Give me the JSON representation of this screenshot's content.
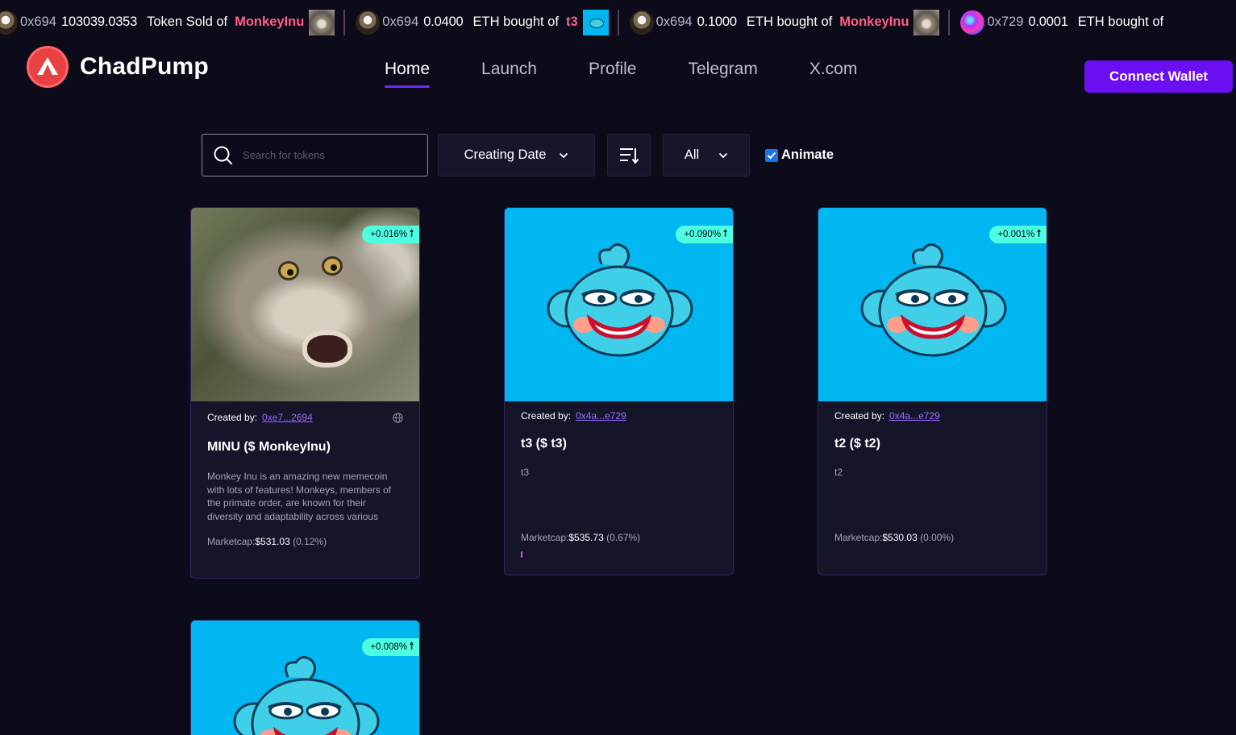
{
  "ticker": [
    {
      "addr": "0x694",
      "amount": "103039.0353",
      "action": "Token Sold of",
      "token": "MonkeyInu",
      "avatar": "eagle-avatar",
      "thumb": "monkey"
    },
    {
      "addr": "0x694",
      "amount": "0.0400",
      "action": "ETH bought of",
      "token": "t3",
      "avatar": "eagle-avatar",
      "thumb": "fish"
    },
    {
      "addr": "0x694",
      "amount": "0.1000",
      "action": "ETH bought of",
      "token": "MonkeyInu",
      "avatar": "eagle-avatar",
      "thumb": "monkey"
    },
    {
      "addr": "0x729",
      "amount": "0.0001",
      "action": "ETH bought of",
      "token": "",
      "avatar": "gradient-avatar",
      "thumb": ""
    }
  ],
  "header": {
    "brand": "ChadPump",
    "nav": [
      "Home",
      "Launch",
      "Profile",
      "Telegram",
      "X.com"
    ],
    "active_nav": "Home",
    "connect_label": "Connect Wallet",
    "accent": "#6b0ef2"
  },
  "controls": {
    "search_placeholder": "Search for tokens",
    "sort_label": "Creating Date",
    "filter_label": "All",
    "animate_label": "Animate",
    "animate_checked": true
  },
  "cards": [
    {
      "badge": "+0.016%",
      "creator_label": "Created by:",
      "creator": "0xe7...2694",
      "name": "MINU ($ MonkeyInu)",
      "description": "Monkey Inu is an amazing new memecoin with lots of features! Monkeys, members of the primate order, are known for their diversity and adaptability across various habitats…",
      "mcap_label": "Marketcap:",
      "mcap_value": "$531.03",
      "mcap_change": " (0.12%)"
    },
    {
      "badge": "+0.090%",
      "creator_label": "Created by:",
      "creator": "0x4a...e729",
      "name": "t3 ($ t3)",
      "description": "t3",
      "mcap_label": "Marketcap:",
      "mcap_value": "$535.73",
      "mcap_change": " (0.67%)"
    },
    {
      "badge": "+0.001%",
      "creator_label": "Created by:",
      "creator": "0x4a...e729",
      "name": "t2 ($ t2)",
      "description": "t2",
      "mcap_label": "Marketcap:",
      "mcap_value": "$530.03",
      "mcap_change": " (0.00%)"
    },
    {
      "badge": "+0.008%"
    }
  ]
}
